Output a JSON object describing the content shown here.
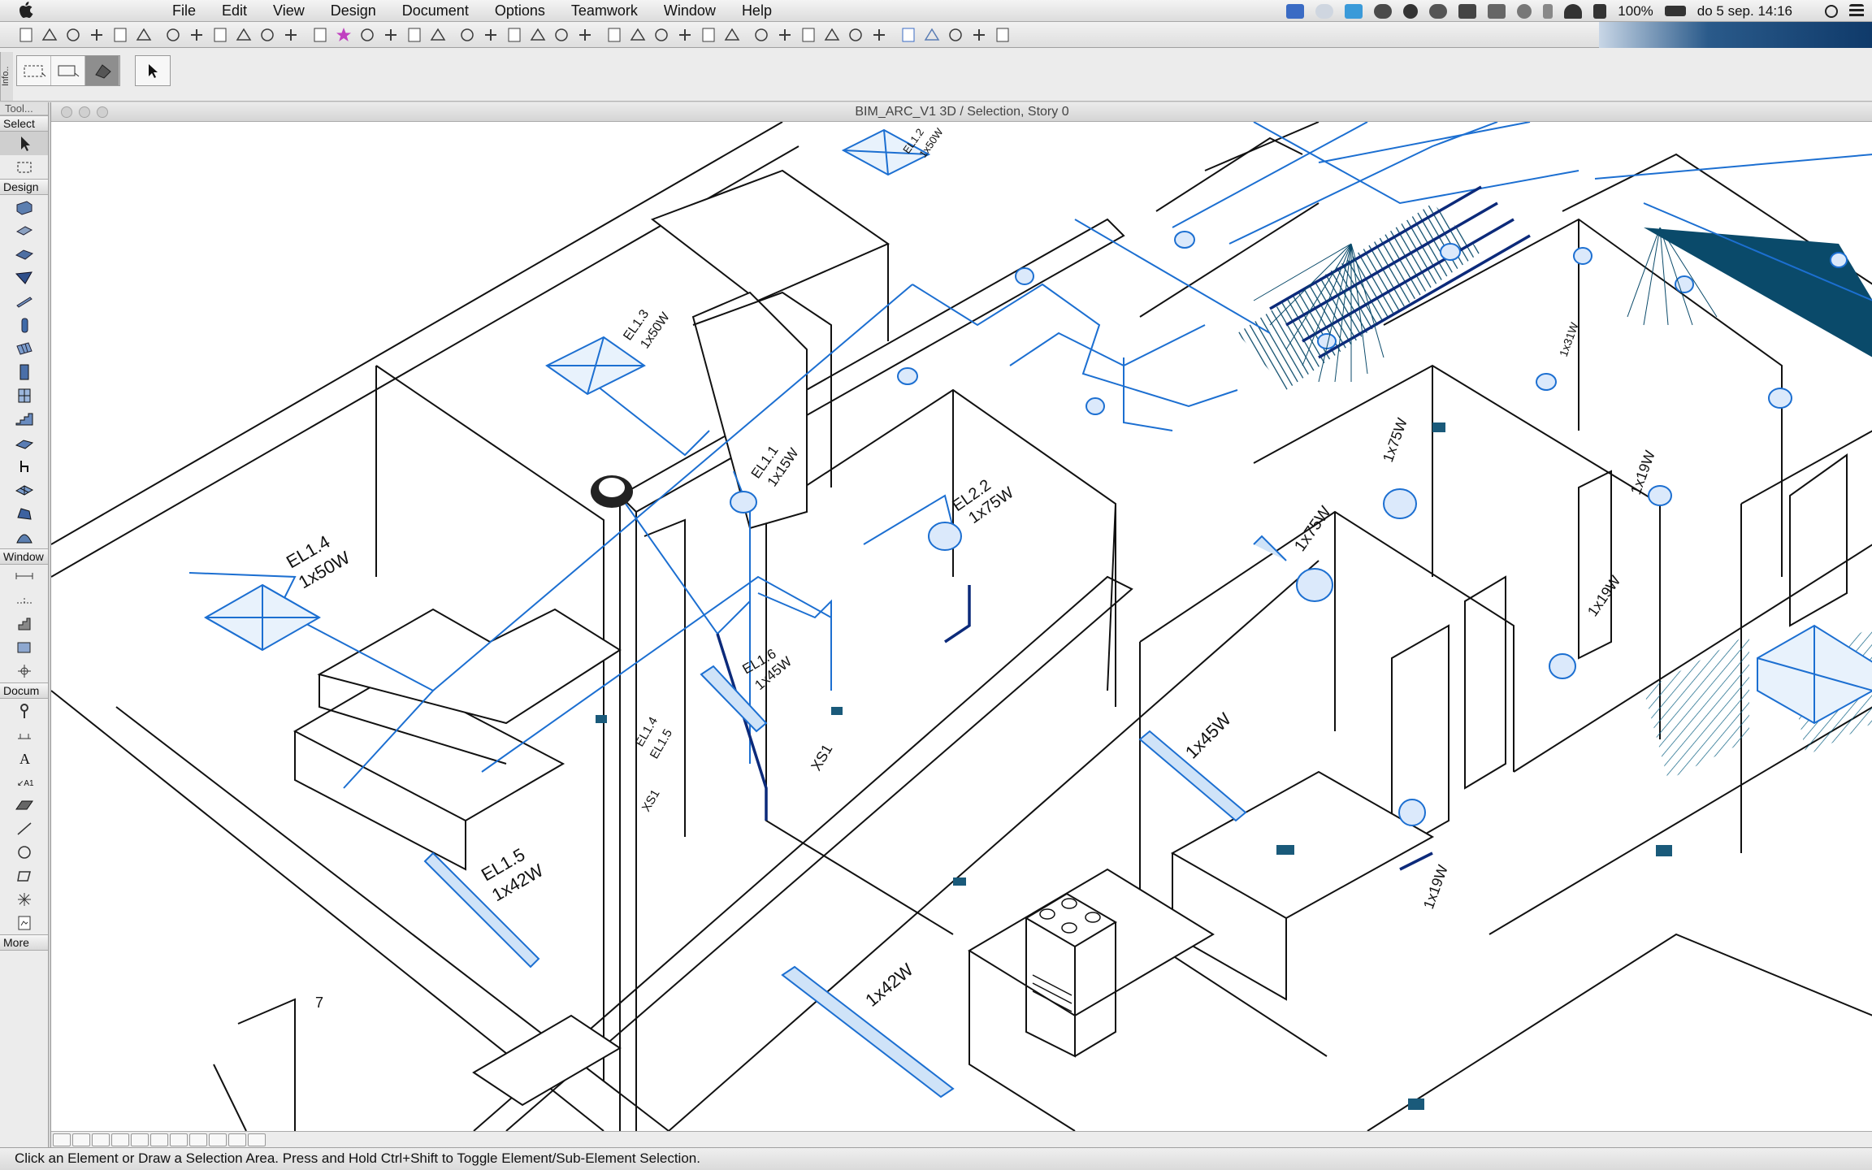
{
  "menubar": {
    "app_name": "",
    "menus": [
      "File",
      "Edit",
      "View",
      "Design",
      "Document",
      "Options",
      "Teamwork",
      "Window",
      "Help"
    ],
    "battery": "100%",
    "datetime": "do 5 sep.  14:16"
  },
  "toolbox": {
    "title": "Tool...",
    "sections": {
      "select": "Select",
      "design": "Design",
      "window": "Window",
      "docum": "Docum",
      "more": "More"
    }
  },
  "info_tab": "Info..",
  "window": {
    "title": "BIM_ARC_V1 3D / Selection, Story 0"
  },
  "labels": {
    "el14": "EL1.4",
    "el14_w": "1x50W",
    "el15": "EL1.5",
    "el15_w": "1x42W",
    "el13": "EL1.3",
    "el13_w": "1x50W",
    "el11": "EL1.1",
    "el11_w": "1x15W",
    "el16": "EL1.6",
    "el16_w": "1x45W",
    "el22": "EL2.2",
    "el22_w": "1x75W",
    "el12": "EL1.2",
    "el12_w": "1x50W",
    "w_1x45": "1x45W",
    "w_1x42": "1x42W",
    "w_1x75": "1x75W",
    "w_1x19a": "1x19W",
    "w_1x19b": "1x19W",
    "w_1x19c": "1x19W",
    "w_1x75b": "1x75W",
    "w_1x31": "1x31W",
    "xs1": "XS1",
    "xs1b": "XS1",
    "el14b": "EL1.4",
    "el15b": "EL1.5",
    "num7": "7"
  },
  "status": {
    "message": "Click an Element or Draw a Selection Area. Press and Hold Ctrl+Shift to Toggle Element/Sub-Element Selection."
  },
  "colors": {
    "wire": "#1c6fd1",
    "wire_dark": "#0c2a7a",
    "line": "#111111",
    "hatch": "#0a4a6a"
  }
}
